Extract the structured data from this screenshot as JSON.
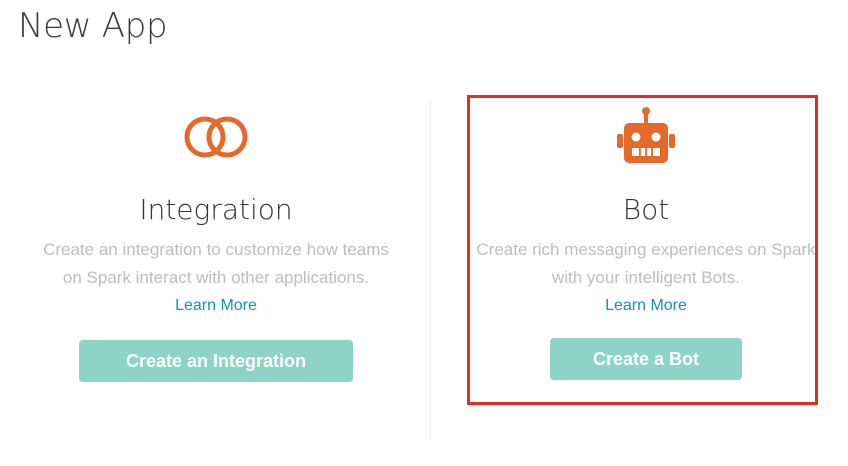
{
  "page": {
    "title": "New App"
  },
  "cards": [
    {
      "icon": "rings-icon",
      "title": "Integration",
      "description": "Create an integration to customize how teams on Spark interact with other applications.",
      "learn_more": "Learn More",
      "button": "Create an Integration"
    },
    {
      "icon": "robot-icon",
      "title": "Bot",
      "description": "Create rich messaging experiences on Spark with your intelligent Bots.",
      "learn_more": "Learn More",
      "button": "Create a Bot"
    }
  ],
  "colors": {
    "accent_orange": "#e5692a",
    "button_teal": "#8dd3c8",
    "link_blue": "#1a8bc6",
    "highlight_red": "#e22b2b"
  }
}
